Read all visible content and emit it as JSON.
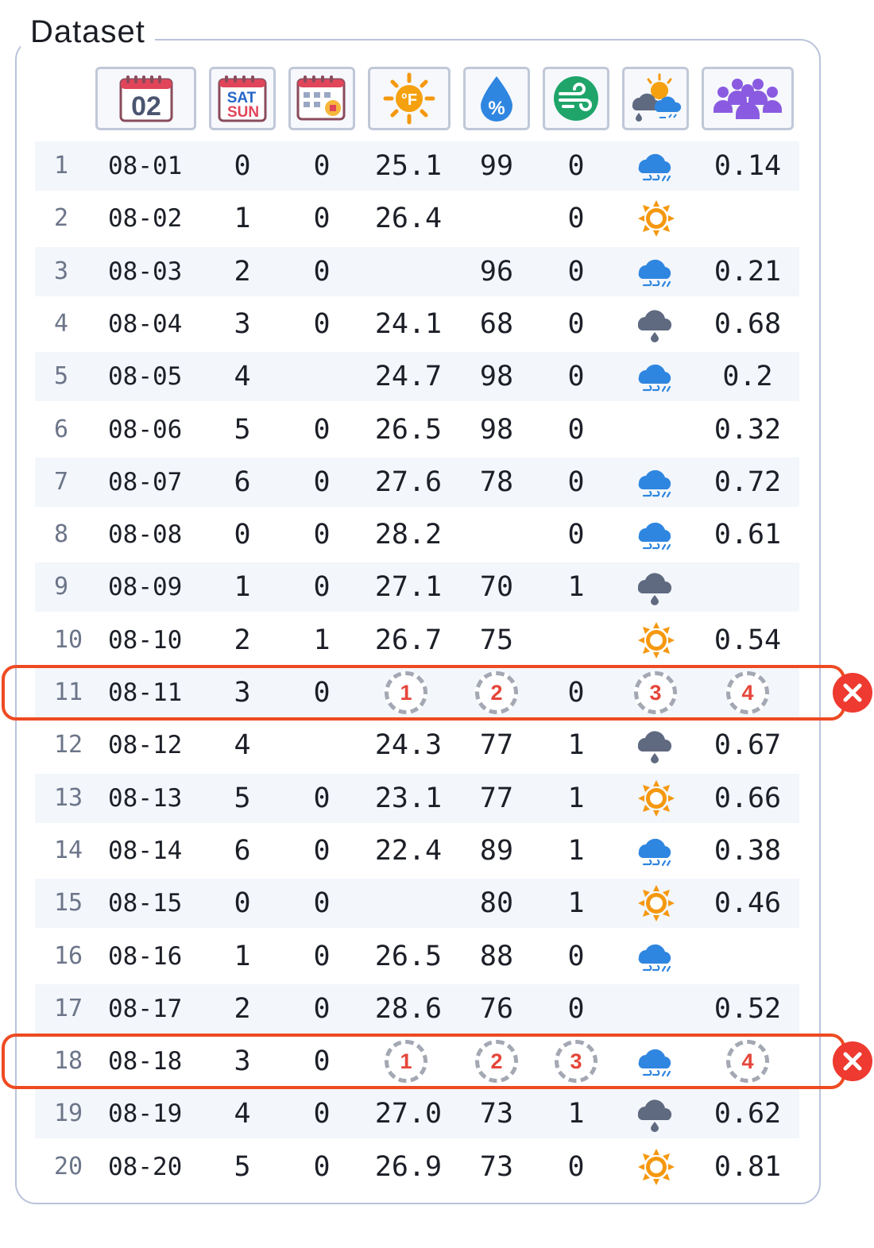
{
  "title": "Dataset",
  "header_icons": [
    "calendar-date-icon",
    "weekend-icon",
    "holiday-calendar-icon",
    "temperature-sun-icon",
    "humidity-drop-icon",
    "wind-icon",
    "weather-mixed-icon",
    "people-group-icon"
  ],
  "header_calendar_text": "02",
  "header_weekend_text": [
    "SAT",
    "SUN"
  ],
  "colors": {
    "accent_red": "#ee4a22",
    "rain_blue": "#2f86e0",
    "sun_orange": "#f5980f",
    "storm_gray": "#5f6a80",
    "badge_red": "#e5463a"
  },
  "rows": [
    {
      "idx": "1",
      "date": "08-01",
      "wd": "0",
      "hol": "0",
      "temp": "25.1",
      "hum": "99",
      "wind": "0",
      "weather": "rain",
      "val": "0.14"
    },
    {
      "idx": "2",
      "date": "08-02",
      "wd": "1",
      "hol": "0",
      "temp": "26.4",
      "hum": "",
      "wind": "0",
      "weather": "sun",
      "val": ""
    },
    {
      "idx": "3",
      "date": "08-03",
      "wd": "2",
      "hol": "0",
      "temp": "",
      "hum": "96",
      "wind": "0",
      "weather": "rain",
      "val": "0.21"
    },
    {
      "idx": "4",
      "date": "08-04",
      "wd": "3",
      "hol": "0",
      "temp": "24.1",
      "hum": "68",
      "wind": "0",
      "weather": "storm",
      "val": "0.68"
    },
    {
      "idx": "5",
      "date": "08-05",
      "wd": "4",
      "hol": "",
      "temp": "24.7",
      "hum": "98",
      "wind": "0",
      "weather": "rain",
      "val": "0.2"
    },
    {
      "idx": "6",
      "date": "08-06",
      "wd": "5",
      "hol": "0",
      "temp": "26.5",
      "hum": "98",
      "wind": "0",
      "weather": "",
      "val": "0.32"
    },
    {
      "idx": "7",
      "date": "08-07",
      "wd": "6",
      "hol": "0",
      "temp": "27.6",
      "hum": "78",
      "wind": "0",
      "weather": "rain",
      "val": "0.72"
    },
    {
      "idx": "8",
      "date": "08-08",
      "wd": "0",
      "hol": "0",
      "temp": "28.2",
      "hum": "",
      "wind": "0",
      "weather": "rain",
      "val": "0.61"
    },
    {
      "idx": "9",
      "date": "08-09",
      "wd": "1",
      "hol": "0",
      "temp": "27.1",
      "hum": "70",
      "wind": "1",
      "weather": "storm",
      "val": ""
    },
    {
      "idx": "10",
      "date": "08-10",
      "wd": "2",
      "hol": "1",
      "temp": "26.7",
      "hum": "75",
      "wind": "",
      "weather": "sun",
      "val": "0.54"
    },
    {
      "idx": "11",
      "date": "08-11",
      "wd": "3",
      "hol": "0",
      "temp": "#1",
      "hum": "#2",
      "wind": "0",
      "weather": "#3",
      "val": "#4",
      "flagged": true
    },
    {
      "idx": "12",
      "date": "08-12",
      "wd": "4",
      "hol": "",
      "temp": "24.3",
      "hum": "77",
      "wind": "1",
      "weather": "storm",
      "val": "0.67"
    },
    {
      "idx": "13",
      "date": "08-13",
      "wd": "5",
      "hol": "0",
      "temp": "23.1",
      "hum": "77",
      "wind": "1",
      "weather": "sun",
      "val": "0.66"
    },
    {
      "idx": "14",
      "date": "08-14",
      "wd": "6",
      "hol": "0",
      "temp": "22.4",
      "hum": "89",
      "wind": "1",
      "weather": "rain",
      "val": "0.38"
    },
    {
      "idx": "15",
      "date": "08-15",
      "wd": "0",
      "hol": "0",
      "temp": "",
      "hum": "80",
      "wind": "1",
      "weather": "sun",
      "val": "0.46"
    },
    {
      "idx": "16",
      "date": "08-16",
      "wd": "1",
      "hol": "0",
      "temp": "26.5",
      "hum": "88",
      "wind": "0",
      "weather": "rain",
      "val": ""
    },
    {
      "idx": "17",
      "date": "08-17",
      "wd": "2",
      "hol": "0",
      "temp": "28.6",
      "hum": "76",
      "wind": "0",
      "weather": "",
      "val": "0.52"
    },
    {
      "idx": "18",
      "date": "08-18",
      "wd": "3",
      "hol": "0",
      "temp": "#1",
      "hum": "#2",
      "wind": "#3",
      "weather": "rain",
      "val": "#4",
      "flagged": true
    },
    {
      "idx": "19",
      "date": "08-19",
      "wd": "4",
      "hol": "0",
      "temp": "27.0",
      "hum": "73",
      "wind": "1",
      "weather": "storm",
      "val": "0.62"
    },
    {
      "idx": "20",
      "date": "08-20",
      "wd": "5",
      "hol": "0",
      "temp": "26.9",
      "hum": "73",
      "wind": "0",
      "weather": "sun",
      "val": "0.81"
    }
  ]
}
